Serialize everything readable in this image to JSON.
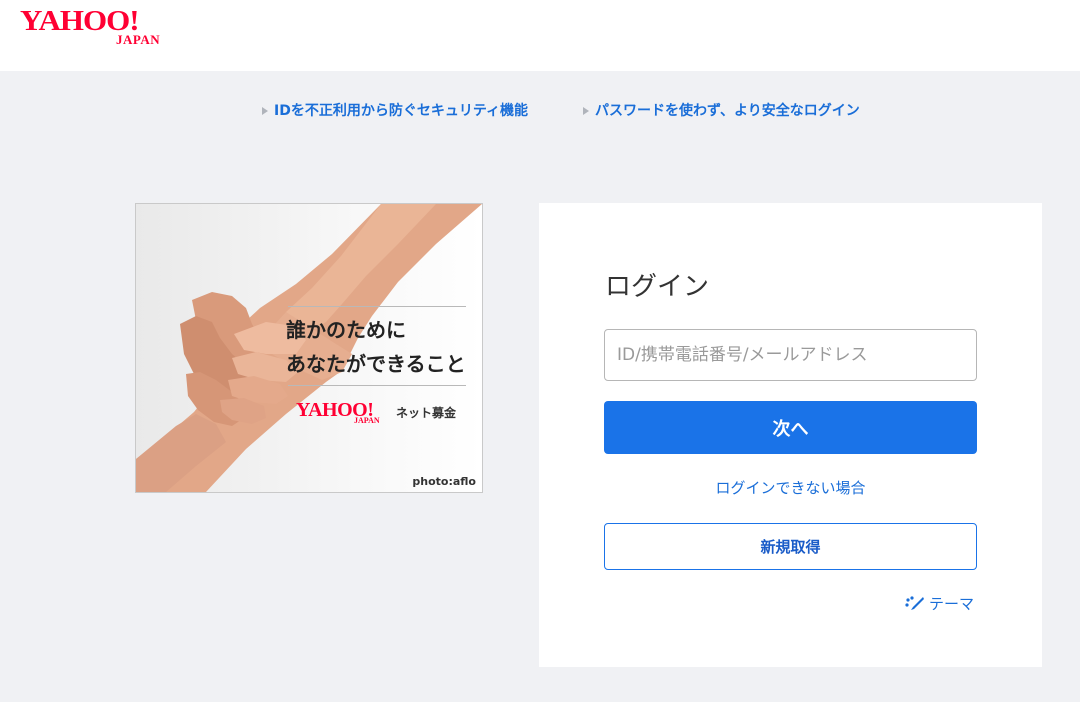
{
  "header": {
    "logo_main": "YAHOO!",
    "logo_sub": "JAPAN"
  },
  "security_links": [
    {
      "label": "IDを不正利用から防ぐセキュリティ機能"
    },
    {
      "label": "パスワードを使わず、より安全なログイン"
    }
  ],
  "ad": {
    "headline_1": "誰かのために",
    "headline_2": "あなたができること",
    "brand_main": "YAHOO!",
    "brand_sub": "JAPAN",
    "brand_service": "ネット募金",
    "credit": "photo:aflo"
  },
  "login": {
    "title": "ログイン",
    "id_placeholder": "ID/携帯電話番号/メールアドレス",
    "id_value": "",
    "next_label": "次へ",
    "trouble_label": "ログインできない場合",
    "register_label": "新規取得",
    "theme_label": "テーマ",
    "theme_icon": "palette-icon"
  },
  "colors": {
    "brand_red": "#ff0033",
    "primary_blue": "#1a73e8",
    "link_blue": "#1a6ed8",
    "page_bg": "#f0f1f4"
  }
}
